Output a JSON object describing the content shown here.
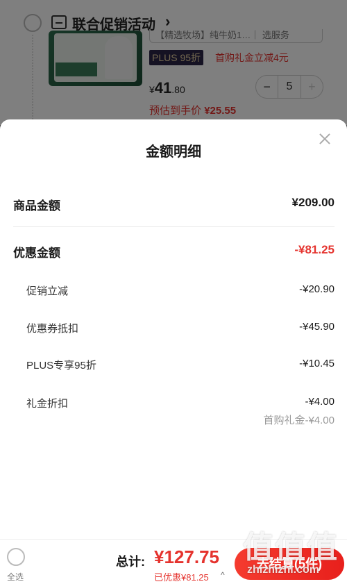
{
  "background_cart": {
    "store_title": "联合促销活动",
    "product_title_truncated": "【精选牧场】纯牛奶1…｜ 选服务",
    "plus_tag": "PLUS 95折",
    "gift_tag": "首购礼金立减4元",
    "price_symbol": "¥",
    "price_int": "41",
    "price_dec": ".80",
    "estimate_label": "预估到手价",
    "estimate_value": "¥25.55",
    "qty": "5",
    "minus": "−",
    "plus": "+"
  },
  "sheet": {
    "title": "金额明细",
    "goods_label": "商品金额",
    "goods_value": "¥209.00",
    "discount_label": "优惠金额",
    "discount_value": "-¥81.25",
    "items": [
      {
        "label": "促销立减",
        "value": "-¥20.90"
      },
      {
        "label": "优惠券抵扣",
        "value": "-¥45.90"
      },
      {
        "label": "PLUS专享95折",
        "value": "-¥10.45"
      },
      {
        "label": "礼金折扣",
        "value": "-¥4.00"
      }
    ],
    "gift_note": "首购礼金-¥4.00"
  },
  "bottom": {
    "select_all": "全选",
    "total_label": "总计:",
    "total_value": "¥127.75",
    "saved": "已优惠¥81.25",
    "saved_caret": "^",
    "checkout": "去结算(5件)"
  },
  "watermark": {
    "main": "值值值",
    "url": "zhizhizhi.com"
  },
  "colors": {
    "accent_red": "#e5332e",
    "plus_bg": "#2a2446",
    "plus_text": "#e6d0a0"
  }
}
